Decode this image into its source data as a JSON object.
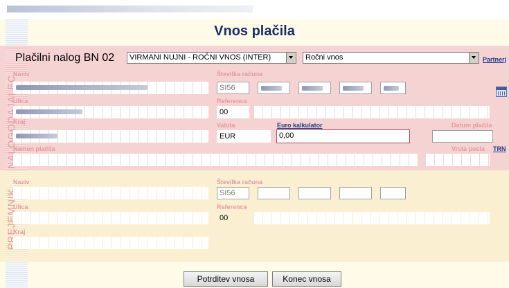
{
  "page": {
    "title": "Vnos plačila"
  },
  "order": {
    "title": "Plačilni nalog BN 02",
    "type_select": "VIRMANI NUJNI - ROČNI VNOS (INTER)",
    "mode_select": "Ročni vnos",
    "partners_link": "Partnerj"
  },
  "payer": {
    "section_label": "NALOGODAJALEC",
    "name_label": "Naziv",
    "street_label": "Ulica",
    "city_label": "Kraj",
    "purpose_label": "Namen plačila",
    "account_label": "Številka računa",
    "account_prefix": "SI56",
    "reference_label": "Referenca",
    "reference_prefix": "00",
    "currency_label": "Valuta",
    "currency_value": "EUR",
    "euro_calc_link": "Euro kalkulator",
    "amount_value": "0,00",
    "payment_date_label": "Datum plačila",
    "payment_type_label": "Vrsta posla",
    "trn_link": "TRN"
  },
  "recipient": {
    "section_label": "PREJEMNIK",
    "name_label": "Naziv",
    "street_label": "Ulica",
    "city_label": "Kraj",
    "account_label": "Številka računa",
    "account_prefix": "SI56",
    "reference_label": "Referenca",
    "reference_prefix": "00"
  },
  "footer": {
    "confirm_button": "Potrditev vnosa",
    "end_button": "Konec vnosa"
  },
  "colors": {
    "payer_bg": "#f6d3d3",
    "recipient_bg": "#fbefd2",
    "title": "#1a2f6a",
    "label": "#e39aa0",
    "link": "#1f3a8a"
  },
  "icons": {
    "calendar": "calendar-icon"
  }
}
